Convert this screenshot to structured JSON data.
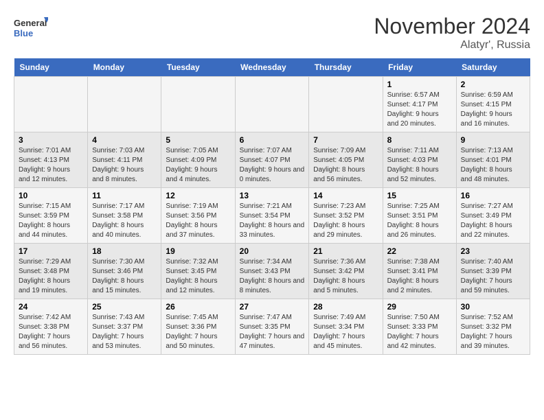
{
  "header": {
    "logo_line1": "General",
    "logo_line2": "Blue",
    "month": "November 2024",
    "location": "Alatyr', Russia"
  },
  "days_of_week": [
    "Sunday",
    "Monday",
    "Tuesday",
    "Wednesday",
    "Thursday",
    "Friday",
    "Saturday"
  ],
  "weeks": [
    [
      {
        "day": "",
        "info": ""
      },
      {
        "day": "",
        "info": ""
      },
      {
        "day": "",
        "info": ""
      },
      {
        "day": "",
        "info": ""
      },
      {
        "day": "",
        "info": ""
      },
      {
        "day": "1",
        "info": "Sunrise: 6:57 AM\nSunset: 4:17 PM\nDaylight: 9 hours and 20 minutes."
      },
      {
        "day": "2",
        "info": "Sunrise: 6:59 AM\nSunset: 4:15 PM\nDaylight: 9 hours and 16 minutes."
      }
    ],
    [
      {
        "day": "3",
        "info": "Sunrise: 7:01 AM\nSunset: 4:13 PM\nDaylight: 9 hours and 12 minutes."
      },
      {
        "day": "4",
        "info": "Sunrise: 7:03 AM\nSunset: 4:11 PM\nDaylight: 9 hours and 8 minutes."
      },
      {
        "day": "5",
        "info": "Sunrise: 7:05 AM\nSunset: 4:09 PM\nDaylight: 9 hours and 4 minutes."
      },
      {
        "day": "6",
        "info": "Sunrise: 7:07 AM\nSunset: 4:07 PM\nDaylight: 9 hours and 0 minutes."
      },
      {
        "day": "7",
        "info": "Sunrise: 7:09 AM\nSunset: 4:05 PM\nDaylight: 8 hours and 56 minutes."
      },
      {
        "day": "8",
        "info": "Sunrise: 7:11 AM\nSunset: 4:03 PM\nDaylight: 8 hours and 52 minutes."
      },
      {
        "day": "9",
        "info": "Sunrise: 7:13 AM\nSunset: 4:01 PM\nDaylight: 8 hours and 48 minutes."
      }
    ],
    [
      {
        "day": "10",
        "info": "Sunrise: 7:15 AM\nSunset: 3:59 PM\nDaylight: 8 hours and 44 minutes."
      },
      {
        "day": "11",
        "info": "Sunrise: 7:17 AM\nSunset: 3:58 PM\nDaylight: 8 hours and 40 minutes."
      },
      {
        "day": "12",
        "info": "Sunrise: 7:19 AM\nSunset: 3:56 PM\nDaylight: 8 hours and 37 minutes."
      },
      {
        "day": "13",
        "info": "Sunrise: 7:21 AM\nSunset: 3:54 PM\nDaylight: 8 hours and 33 minutes."
      },
      {
        "day": "14",
        "info": "Sunrise: 7:23 AM\nSunset: 3:52 PM\nDaylight: 8 hours and 29 minutes."
      },
      {
        "day": "15",
        "info": "Sunrise: 7:25 AM\nSunset: 3:51 PM\nDaylight: 8 hours and 26 minutes."
      },
      {
        "day": "16",
        "info": "Sunrise: 7:27 AM\nSunset: 3:49 PM\nDaylight: 8 hours and 22 minutes."
      }
    ],
    [
      {
        "day": "17",
        "info": "Sunrise: 7:29 AM\nSunset: 3:48 PM\nDaylight: 8 hours and 19 minutes."
      },
      {
        "day": "18",
        "info": "Sunrise: 7:30 AM\nSunset: 3:46 PM\nDaylight: 8 hours and 15 minutes."
      },
      {
        "day": "19",
        "info": "Sunrise: 7:32 AM\nSunset: 3:45 PM\nDaylight: 8 hours and 12 minutes."
      },
      {
        "day": "20",
        "info": "Sunrise: 7:34 AM\nSunset: 3:43 PM\nDaylight: 8 hours and 8 minutes."
      },
      {
        "day": "21",
        "info": "Sunrise: 7:36 AM\nSunset: 3:42 PM\nDaylight: 8 hours and 5 minutes."
      },
      {
        "day": "22",
        "info": "Sunrise: 7:38 AM\nSunset: 3:41 PM\nDaylight: 8 hours and 2 minutes."
      },
      {
        "day": "23",
        "info": "Sunrise: 7:40 AM\nSunset: 3:39 PM\nDaylight: 7 hours and 59 minutes."
      }
    ],
    [
      {
        "day": "24",
        "info": "Sunrise: 7:42 AM\nSunset: 3:38 PM\nDaylight: 7 hours and 56 minutes."
      },
      {
        "day": "25",
        "info": "Sunrise: 7:43 AM\nSunset: 3:37 PM\nDaylight: 7 hours and 53 minutes."
      },
      {
        "day": "26",
        "info": "Sunrise: 7:45 AM\nSunset: 3:36 PM\nDaylight: 7 hours and 50 minutes."
      },
      {
        "day": "27",
        "info": "Sunrise: 7:47 AM\nSunset: 3:35 PM\nDaylight: 7 hours and 47 minutes."
      },
      {
        "day": "28",
        "info": "Sunrise: 7:49 AM\nSunset: 3:34 PM\nDaylight: 7 hours and 45 minutes."
      },
      {
        "day": "29",
        "info": "Sunrise: 7:50 AM\nSunset: 3:33 PM\nDaylight: 7 hours and 42 minutes."
      },
      {
        "day": "30",
        "info": "Sunrise: 7:52 AM\nSunset: 3:32 PM\nDaylight: 7 hours and 39 minutes."
      }
    ]
  ]
}
